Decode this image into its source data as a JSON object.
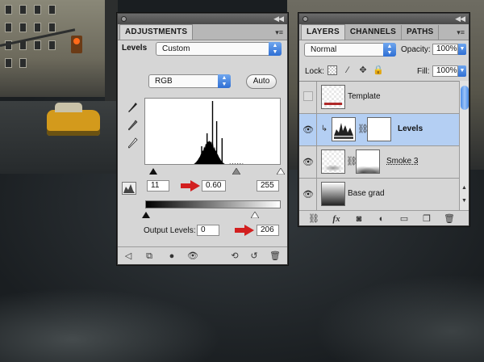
{
  "adjustments": {
    "tab": "ADJUSTMENTS",
    "preset_label": "Levels",
    "preset_value": "Custom",
    "channel_value": "RGB",
    "auto_label": "Auto",
    "input_black": "11",
    "input_gamma": "0.60",
    "input_white": "255",
    "output_label": "Output Levels:",
    "output_black": "0",
    "output_white": "206"
  },
  "layers": {
    "tabs": [
      "LAYERS",
      "CHANNELS",
      "PATHS"
    ],
    "blend_mode": "Normal",
    "opacity_label": "Opacity:",
    "opacity_value": "100%",
    "lock_label": "Lock:",
    "fill_label": "Fill:",
    "fill_value": "100%",
    "rows": [
      {
        "name": "Template",
        "visible": false,
        "selected": false
      },
      {
        "name": "Levels",
        "visible": true,
        "selected": true
      },
      {
        "name": "Smoke 3",
        "visible": true,
        "selected": false
      },
      {
        "name": "Base grad",
        "visible": true,
        "selected": false
      }
    ]
  },
  "icons": {
    "eye": "eye-icon",
    "chain": "chain-link-icon",
    "lock_pixels": "lock-transparent-icon",
    "lock_brush": "brush-icon",
    "lock_move": "move-icon",
    "lock_all": "padlock-icon"
  },
  "colors": {
    "panel_bg": "#d6d6d6",
    "selected_row": "#b4cff3",
    "accent_blue": "#2f6fd4",
    "annotation_red": "#d21f1f"
  }
}
